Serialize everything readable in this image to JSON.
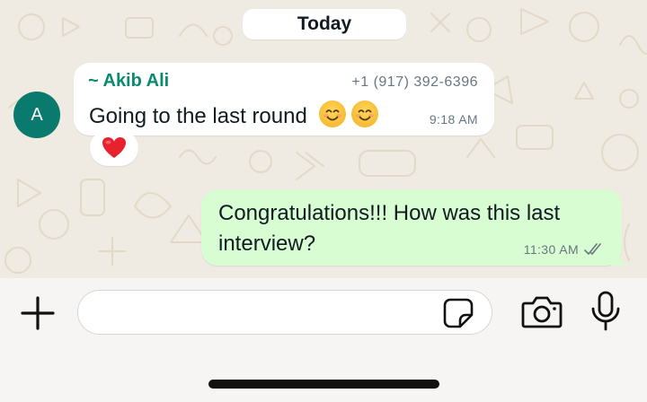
{
  "date_separator": "Today",
  "incoming_message": {
    "avatar_initial": "A",
    "sender_name": "~ Akib Ali",
    "sender_phone": "+1 (917) 392-6396",
    "text": "Going to the last round",
    "emojis": [
      "smiling-face-with-smiling-eyes",
      "smiling-face-with-smiling-eyes"
    ],
    "time": "9:18 AM",
    "reaction": "red-heart"
  },
  "outgoing_message": {
    "text": "Congratulations!!! How was this last interview?",
    "time": "11:30 AM",
    "status": "delivered-double-tick"
  },
  "composer": {
    "placeholder": "",
    "icons": [
      "plus-icon",
      "sticker-icon",
      "camera-icon",
      "microphone-icon"
    ]
  },
  "colors": {
    "wallpaper": "#efeae2",
    "incoming_bubble": "#ffffff",
    "outgoing_bubble": "#d9fdd3",
    "sender_name": "#0b8a6f",
    "avatar": "#0b7a6e",
    "timestamp": "#667781"
  }
}
